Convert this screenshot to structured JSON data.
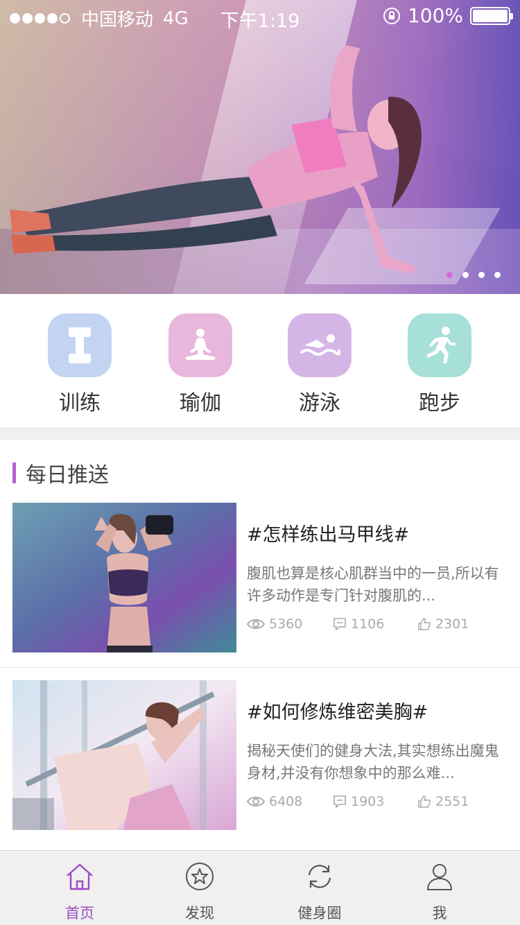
{
  "status_bar": {
    "carrier": "中国移动",
    "network": "4G",
    "time": "下午1:19",
    "battery": "100%",
    "battery_level": 1.0
  },
  "banner": {
    "slide_count": 4,
    "active_slide": 1
  },
  "categories": [
    {
      "label": "训练",
      "icon": "dumbbell-icon",
      "color": "#c3d3f2"
    },
    {
      "label": "瑜伽",
      "icon": "yoga-icon",
      "color": "#e9b6dc"
    },
    {
      "label": "游泳",
      "icon": "swimming-icon",
      "color": "#d4b6e6"
    },
    {
      "label": "跑步",
      "icon": "running-icon",
      "color": "#a7dfd9"
    }
  ],
  "daily_push": {
    "title": "每日推送",
    "accent": "#b65fd1",
    "articles": [
      {
        "title": "#怎样练出马甲线#",
        "desc": "腹肌也算是核心肌群当中的一员,所以有许多动作是专门针对腹肌的...",
        "views": "5360",
        "comments": "1106",
        "likes": "2301"
      },
      {
        "title": "#如何修炼维密美胸#",
        "desc": "揭秘天使们的健身大法,其实想练出魔鬼身材,并没有你想象中的那么难...",
        "views": "6408",
        "comments": "1903",
        "likes": "2551"
      }
    ]
  },
  "tab_bar": {
    "items": [
      {
        "label": "首页",
        "icon": "home-icon"
      },
      {
        "label": "发现",
        "icon": "star-icon"
      },
      {
        "label": "健身圈",
        "icon": "refresh-icon"
      },
      {
        "label": "我",
        "icon": "user-icon"
      }
    ],
    "active_color": "#9b4bc4"
  }
}
